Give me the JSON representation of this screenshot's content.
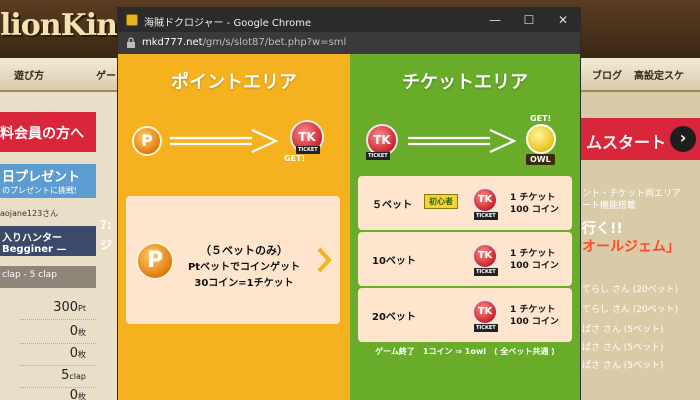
{
  "background": {
    "logo": "lionKing",
    "nav": [
      "遊び方",
      "ゲー",
      "ブログ",
      "高設定スケ"
    ],
    "left": {
      "member_button": "料会員の方へ",
      "present_title": "日プレゼント",
      "present_sub": "のプレゼントに挑戦!",
      "user": "aojane123さん",
      "hunter_title": "入りハンター",
      "hunter_sub": "Begginer —",
      "clap": "clap - 5 clap",
      "stats": [
        {
          "value": "300",
          "unit": "Pt"
        },
        {
          "value": "0",
          "unit": "枚"
        },
        {
          "value": "0",
          "unit": "枚"
        },
        {
          "value": "5",
          "unit": "clap"
        },
        {
          "value": "0",
          "unit": "枚"
        }
      ]
    },
    "mid_texts": [
      "?:",
      "ジ"
    ],
    "right": {
      "start_button": "ムスタート",
      "info1": "ント・チケット両エリア",
      "info2": "ート機能搭載",
      "headline1": "行く!!",
      "headline2": "オールジェム」",
      "list": [
        "てらし さん (20ベット)",
        "てらし さん (20ベット)",
        "ぱさ さん (5ベット)",
        "ぱさ さん (5ベット)",
        "ぱさ さん (5ベット)"
      ]
    }
  },
  "window": {
    "title": "海賊ドクロジャー - Google Chrome",
    "url_domain": "mkd777.net",
    "url_path": "/gm/s/slot87/bet.php?w=sml",
    "controls": {
      "minimize": "—",
      "maximize": "☐",
      "close": "✕"
    }
  },
  "point_area": {
    "title": "ポイントエリア",
    "p_symbol": "P",
    "tk_symbol": "TK",
    "tk_tag": "TICKET",
    "get_label": "GET!",
    "card": {
      "line1": "（５ベットのみ）",
      "line2": "Ptベットでコインゲット",
      "line3": "30コイン=1チケット"
    }
  },
  "ticket_area": {
    "title": "チケットエリア",
    "tk_symbol": "TK",
    "tk_tag": "TICKET",
    "get_label": "GET!",
    "owl_tag": "OWL",
    "bets": [
      {
        "label": "５ベット",
        "badge": "初心者",
        "reward_ticket": "1 チケット",
        "reward_coin": "100 コイン"
      },
      {
        "label": "10ベット",
        "badge": "",
        "reward_ticket": "1 チケット",
        "reward_coin": "100 コイン"
      },
      {
        "label": "20ベット",
        "badge": "",
        "reward_ticket": "1 チケット",
        "reward_coin": "100 コイン"
      }
    ],
    "footnote": "ゲーム終了　1コイン ⇒ 1owl　( 全ベット共通 )"
  },
  "colors": {
    "point_bg": "#f5b21e",
    "ticket_bg": "#68ac2a",
    "card_bg": "#ffe4ce",
    "tk_red": "#c9242c"
  }
}
